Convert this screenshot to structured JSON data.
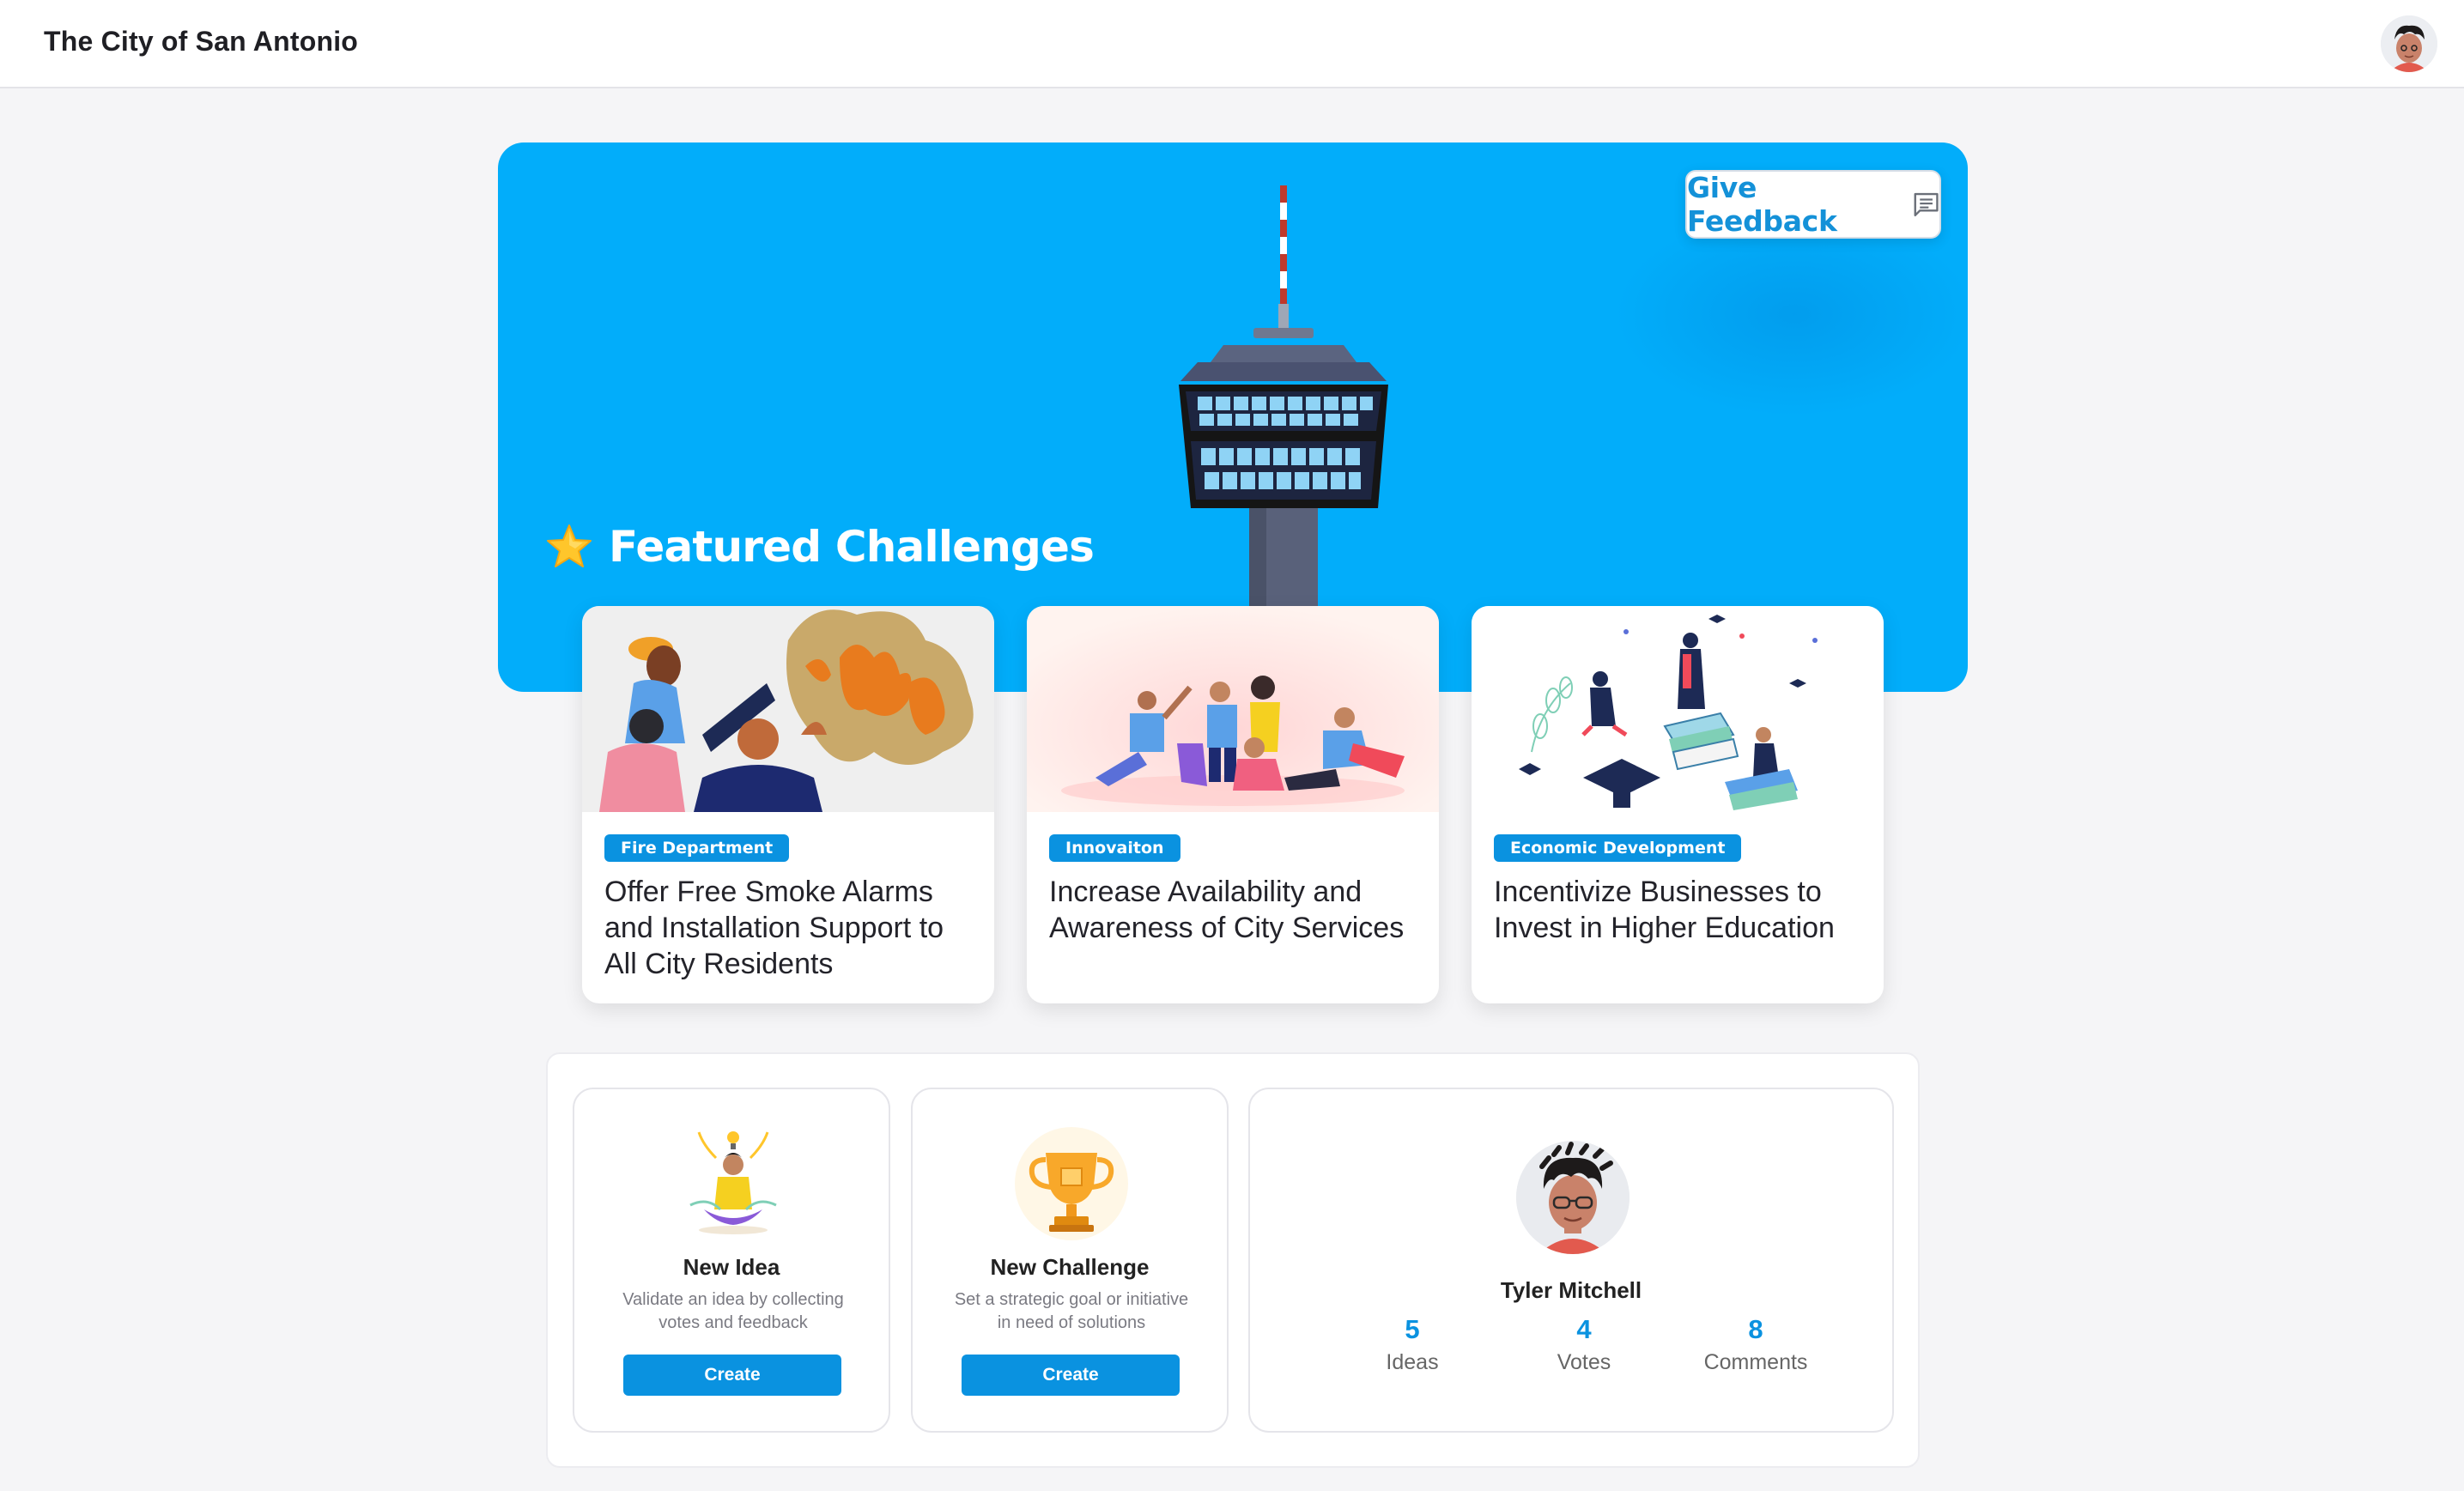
{
  "header": {
    "title": "The City of San Antonio"
  },
  "hero": {
    "feedback_label": "Give Feedback",
    "featured_title": "Featured Challenges"
  },
  "challenges": [
    {
      "badge": "Fire Department",
      "title": "Offer Free Smoke Alarms and Installation Support to All City Residents"
    },
    {
      "badge": "Innovaiton",
      "title": "Increase Availability and Awareness of City Services"
    },
    {
      "badge": "Economic Development",
      "title": "Incentivize Businesses to Invest in Higher Education"
    }
  ],
  "actions": [
    {
      "title": "New Idea",
      "description": "Validate an idea by collecting votes and feedback",
      "button": "Create"
    },
    {
      "title": "New Challenge",
      "description": "Set a strategic goal or initiative in need of solutions",
      "button": "Create"
    }
  ],
  "profile": {
    "name": "Tyler Mitchell",
    "stats": [
      {
        "value": "5",
        "label": "Ideas"
      },
      {
        "value": "4",
        "label": "Votes"
      },
      {
        "value": "8",
        "label": "Comments"
      }
    ]
  },
  "colors": {
    "hero_blue": "#02adfa",
    "accent": "#0a92e0",
    "feedback_text": "#1491d8"
  },
  "icons": [
    "avatar-icon",
    "comment-icon",
    "star-icon",
    "tower-illustration",
    "lotus-idea-icon",
    "trophy-icon"
  ]
}
